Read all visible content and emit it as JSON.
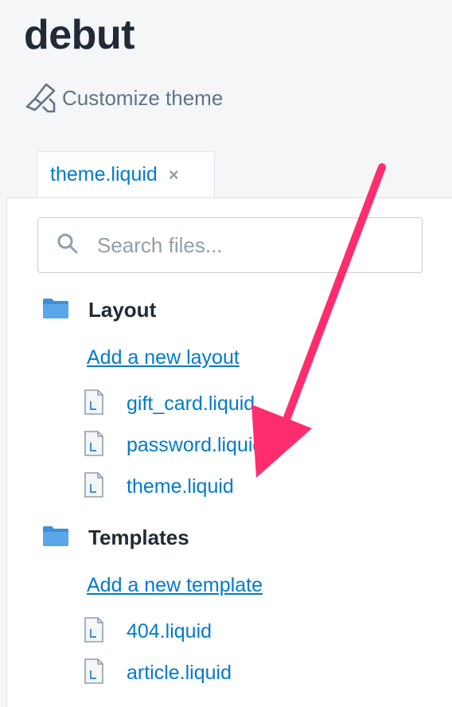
{
  "theme": {
    "name": "debut",
    "customize_label": "Customize theme"
  },
  "tab": {
    "label": "theme.liquid",
    "close_glyph": "×"
  },
  "search": {
    "placeholder": "Search files..."
  },
  "sections": [
    {
      "title": "Layout",
      "add_label": "Add a new layout",
      "files": [
        "gift_card.liquid",
        "password.liquid",
        "theme.liquid"
      ]
    },
    {
      "title": "Templates",
      "add_label": "Add a new template",
      "files": [
        "404.liquid",
        "article.liquid"
      ]
    }
  ],
  "colors": {
    "link": "#007ace",
    "arrow": "#ff2d6e",
    "folder": "#3d8fd8",
    "heading": "#212b36"
  },
  "icons": {
    "customize": "brush-icon",
    "search": "search-icon",
    "folder": "folder-icon",
    "file": "liquid-file-icon"
  }
}
